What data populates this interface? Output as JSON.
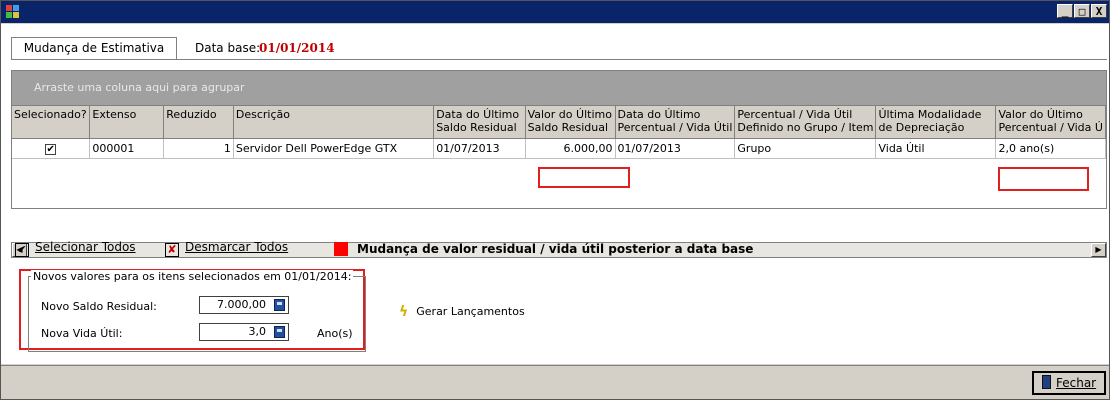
{
  "window": {
    "title": "",
    "controls": {
      "minimize": "_",
      "maximize": "□",
      "close": "X"
    }
  },
  "tab": {
    "label": "Mudança de Estimativa"
  },
  "database": {
    "label": "Data base:",
    "value": "01/01/2014"
  },
  "grid": {
    "group_hint": "Arraste uma coluna aqui para agrupar",
    "columns": [
      {
        "l1": "Selecionado?",
        "l2": ""
      },
      {
        "l1": "Extenso",
        "l2": ""
      },
      {
        "l1": "Reduzido",
        "l2": ""
      },
      {
        "l1": "Descrição",
        "l2": ""
      },
      {
        "l1": "Data do Último",
        "l2": "Saldo Residual"
      },
      {
        "l1": "Valor do Último",
        "l2": "Saldo Residual"
      },
      {
        "l1": "Data do Último",
        "l2": "Percentual / Vida Útil"
      },
      {
        "l1": "Percentual / Vida Útil",
        "l2": "Definido no Grupo / Item"
      },
      {
        "l1": "Última Modalidade",
        "l2": "de Depreciação"
      },
      {
        "l1": "Valor do Último",
        "l2": "Percentual / Vida Ú"
      }
    ],
    "rows": [
      {
        "selected": "✔",
        "extenso": "000001",
        "reduzido": "1",
        "descricao": "Servidor Dell PowerEdge GTX",
        "data_saldo": "01/07/2013",
        "valor_saldo": "6.000,00",
        "data_percentual": "01/07/2013",
        "definido": "Grupo",
        "modalidade": "Vida Útil",
        "valor_percentual": "2,0 ano(s)"
      }
    ]
  },
  "actions": {
    "select_all": "Selecionar Todos",
    "deselect_all": "Desmarcar Todos"
  },
  "legend": {
    "text": "Mudança de valor residual / vida útil posterior a data base",
    "color": "#ff0000"
  },
  "new_values": {
    "title": "Novos valores para os itens selecionados em  01/01/2014:",
    "saldo_label": "Novo Saldo Residual:",
    "saldo_value": "7.000,00",
    "vida_label": "Nova Vida Útil:",
    "vida_value": "3,0",
    "vida_unit": "Ano(s)"
  },
  "generate": {
    "label": "Gerar Lançamentos"
  },
  "close_button": {
    "label": "Fechar"
  },
  "colors": {
    "titlebar": "#0a246a",
    "highlight": "#e02020",
    "base_date": "#c00000"
  }
}
